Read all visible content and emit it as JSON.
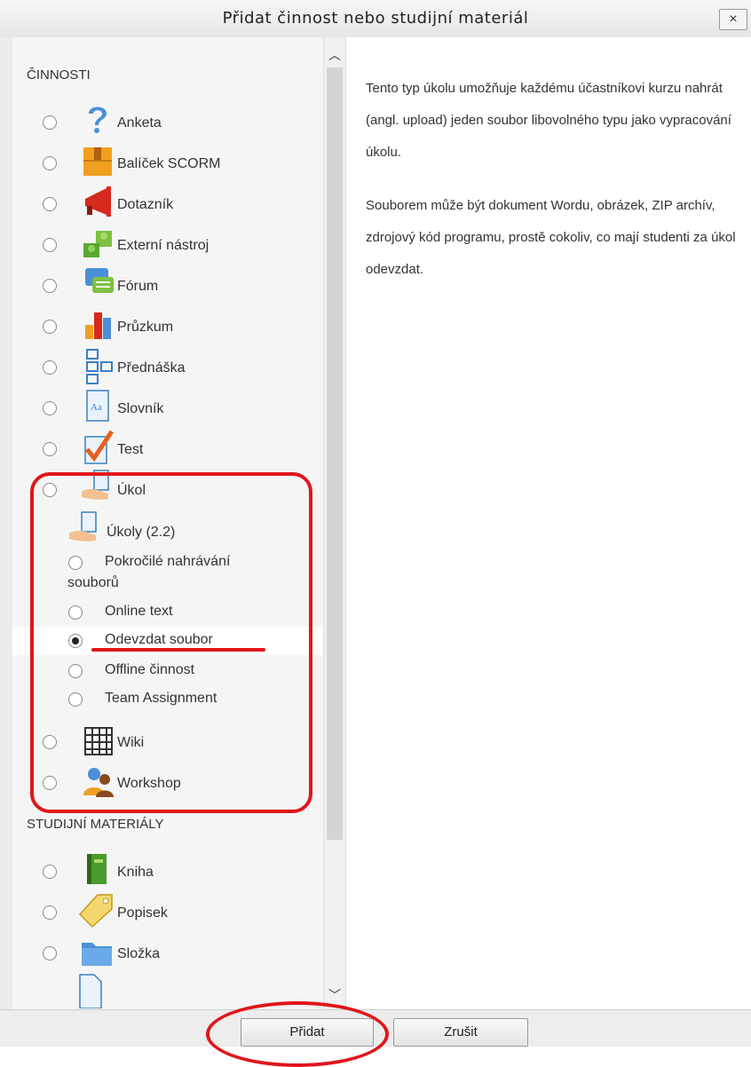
{
  "dialog": {
    "title": "Přidat činnost nebo studijní materiál",
    "close_label": "×"
  },
  "sections": {
    "activities": "ČINNOSTI",
    "resources": "STUDIJNÍ MATERIÁLY"
  },
  "activities": [
    {
      "label": "Anketa",
      "icon": "question-icon"
    },
    {
      "label": "Balíček SCORM",
      "icon": "package-icon"
    },
    {
      "label": "Dotazník",
      "icon": "megaphone-icon"
    },
    {
      "label": "Externí nástroj",
      "icon": "puzzle-icon"
    },
    {
      "label": "Fórum",
      "icon": "forum-icon"
    },
    {
      "label": "Průzkum",
      "icon": "bar-chart-icon"
    },
    {
      "label": "Přednáška",
      "icon": "lesson-icon"
    },
    {
      "label": "Slovník",
      "icon": "glossary-icon"
    },
    {
      "label": "Test",
      "icon": "quiz-checkmark-icon"
    },
    {
      "label": "Úkol",
      "icon": "assignment-icon"
    }
  ],
  "assignment_group": {
    "label": "Úkoly (2.2)",
    "options": [
      {
        "label": "Pokročilé nahrávání",
        "label2": "souborů"
      },
      {
        "label": "Online text"
      },
      {
        "label": "Odevzdat soubor",
        "selected": true
      },
      {
        "label": "Offline činnost"
      },
      {
        "label": "Team Assignment"
      }
    ]
  },
  "activities_tail": [
    {
      "label": "Wiki",
      "icon": "wiki-icon"
    },
    {
      "label": "Workshop",
      "icon": "workshop-icon"
    }
  ],
  "resources": [
    {
      "label": "Kniha",
      "icon": "book-icon"
    },
    {
      "label": "Popisek",
      "icon": "label-tag-icon"
    },
    {
      "label": "Složka",
      "icon": "folder-icon"
    }
  ],
  "description": {
    "p1": "Tento typ úkolu umožňuje každému účastníkovi kurzu nahrát (angl. upload) jeden soubor libovolného typu jako vypracování úkolu.",
    "p2": "Souborem může být dokument Wordu, obrázek, ZIP archív, zdrojový kód programu, prostě cokoliv, co mají studenti za úkol odevzdat."
  },
  "buttons": {
    "add": "Přidat",
    "cancel": "Zrušit"
  },
  "colors": {
    "annotation": "#e0161b"
  }
}
